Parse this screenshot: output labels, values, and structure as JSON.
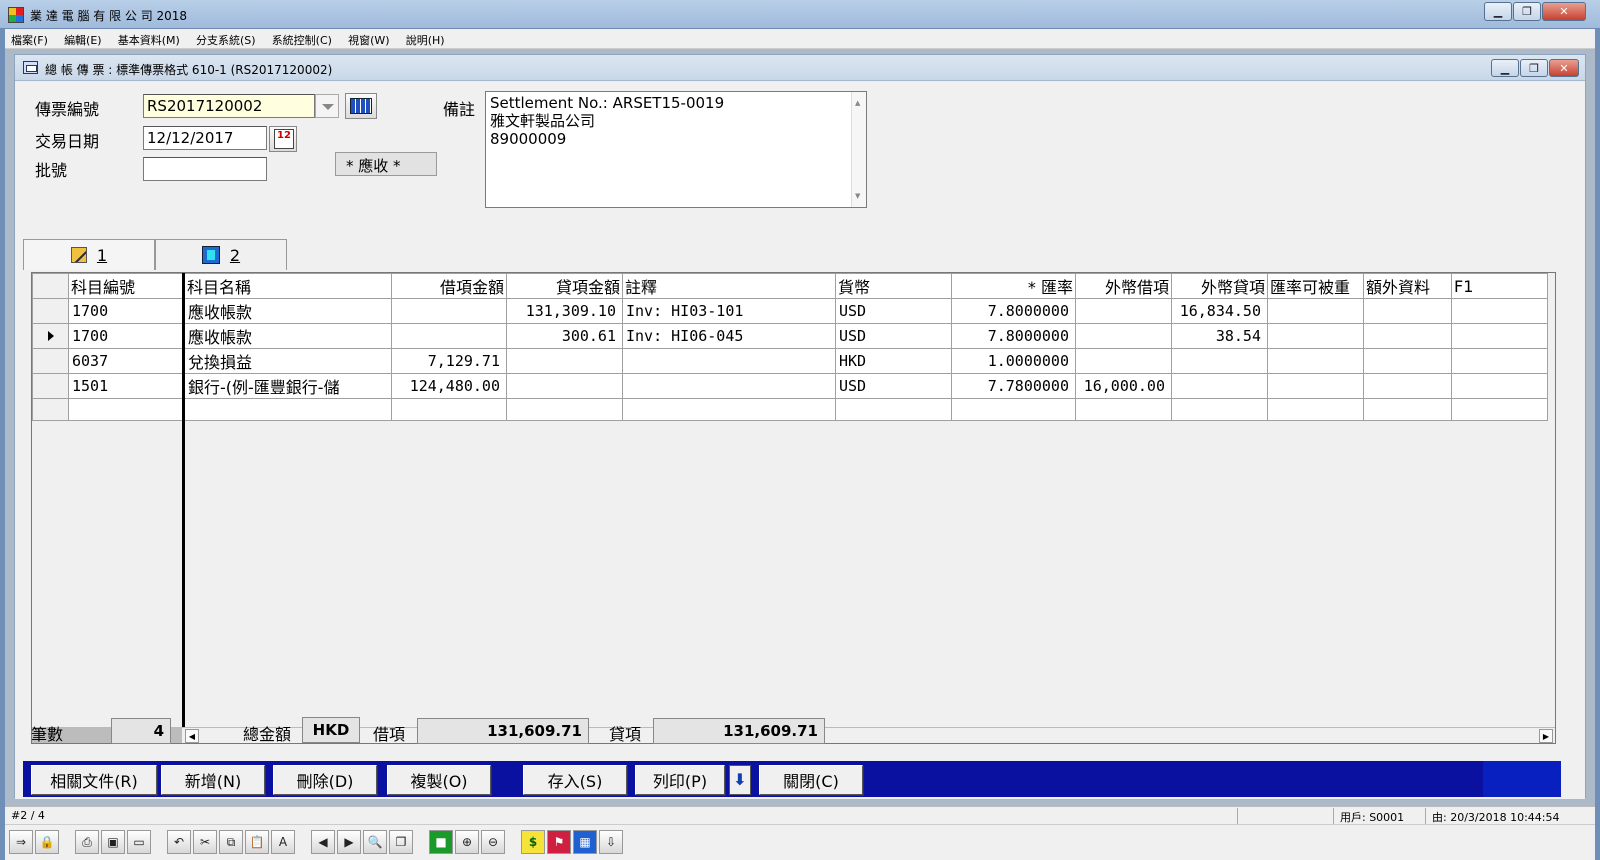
{
  "window": {
    "title": "業 達 電 腦 有 限 公 司 2018",
    "controls": [
      "min",
      "restore",
      "close"
    ]
  },
  "menu": [
    "檔案(F)",
    "編輯(E)",
    "基本資料(M)",
    "分支系統(S)",
    "系統控制(C)",
    "視窗(W)",
    "說明(H)"
  ],
  "child": {
    "title": "總 帳 傳 票 : 標準傳票格式 610-1 (RS2017120002)"
  },
  "form": {
    "voucher_no_label": "傳票編號",
    "voucher_no": "RS2017120002",
    "trans_date_label": "交易日期",
    "trans_date": "12/12/2017",
    "batch_label": "批號",
    "batch_value": "",
    "status_badge": "* 應收 *",
    "remarks_label": "備註",
    "remarks_lines": [
      "Settlement No.: ARSET15-0019",
      "雅文軒製品公司",
      "89000009"
    ],
    "cal_icon_text": "12"
  },
  "tabs": [
    {
      "label": "1",
      "icon": "pencil-icon"
    },
    {
      "label": "2",
      "icon": "hand-icon"
    }
  ],
  "grid": {
    "headers": [
      "科目編號",
      "科目名稱",
      "借項金額",
      "貸項金額",
      "註釋",
      "貨幣",
      "* 匯率",
      "外幣借項",
      "外幣貸項",
      "匯率可被重",
      "額外資料",
      "F1"
    ],
    "rows": [
      {
        "pointer": false,
        "code": "1700",
        "name": "應收帳款",
        "debit": "",
        "credit": "131,309.10",
        "note": "Inv: HI03-101",
        "currency": "USD",
        "rate": "7.8000000",
        "fx_debit": "",
        "fx_credit": "16,834.50",
        "c10": "",
        "c11": "",
        "c12": ""
      },
      {
        "pointer": true,
        "code": "1700",
        "name": "應收帳款",
        "debit": "",
        "credit": "300.61",
        "note": "Inv: HI06-045",
        "currency": "USD",
        "rate": "7.8000000",
        "fx_debit": "",
        "fx_credit": "38.54",
        "c10": "",
        "c11": "",
        "c12": ""
      },
      {
        "pointer": false,
        "code": "6037",
        "name": "兌換損益",
        "debit": "7,129.71",
        "credit": "",
        "note": "",
        "currency": "HKD",
        "rate": "1.0000000",
        "fx_debit": "",
        "fx_credit": "",
        "c10": "",
        "c11": "",
        "c12": ""
      },
      {
        "pointer": false,
        "code": "1501",
        "name": "銀行-(例-匯豐銀行-儲",
        "debit": "124,480.00",
        "credit": "",
        "note": "",
        "currency": "USD",
        "rate": "7.7800000",
        "fx_debit": "16,000.00",
        "fx_credit": "",
        "c10": "",
        "c11": "",
        "c12": ""
      },
      {
        "pointer": false,
        "code": "",
        "name": "",
        "debit": "",
        "credit": "",
        "note": "",
        "currency": "",
        "rate": "",
        "fx_debit": "",
        "fx_credit": "",
        "c10": "",
        "c11": "",
        "c12": ""
      }
    ]
  },
  "totals": {
    "count_label": "筆數",
    "count": "4",
    "total_label": "總金額",
    "currency": "HKD",
    "debit_label": "借項",
    "debit_total": "131,609.71",
    "credit_label": "貸項",
    "credit_total": "131,609.71"
  },
  "buttons": {
    "related_docs": "相關文件(R)",
    "add": "新增(N)",
    "delete": "刪除(D)",
    "copy": "複製(O)",
    "save": "存入(S)",
    "print": "列印(P)",
    "close": "關閉(C)",
    "print_arrow": "⬇"
  },
  "status": {
    "record": "#2 / 4",
    "user": "用戶: S0001",
    "time": "由: 20/3/2018 10:44:54"
  },
  "colors": {
    "button_strip": "#0a10a0",
    "title_gradient": "#b9cfe8"
  }
}
